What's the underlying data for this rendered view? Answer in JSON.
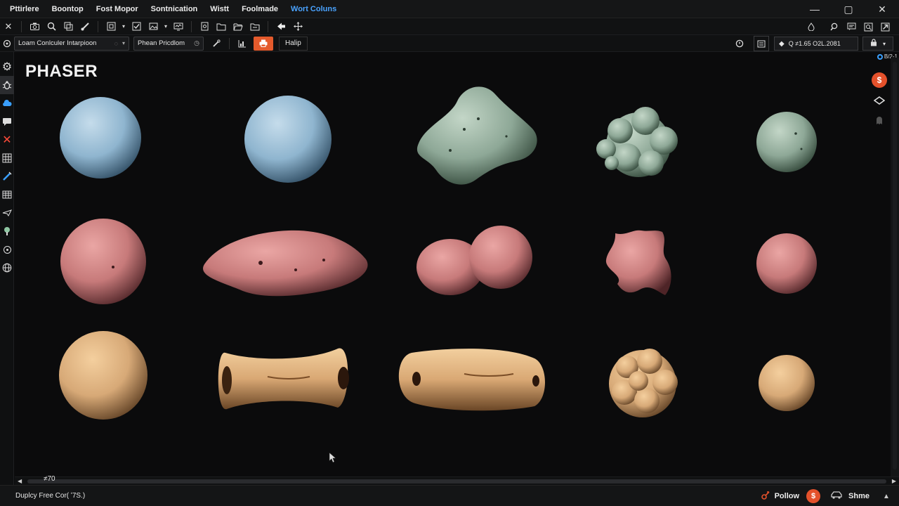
{
  "menubar": {
    "items": [
      "Pttirlere",
      "Boontop",
      "Fost Mopor",
      "Sontnication",
      "Wistt",
      "Foolmade",
      "Wort Coluns"
    ],
    "active_index": 6
  },
  "window_controls": {
    "minimize": "—",
    "maximize": "▢",
    "close": "✕"
  },
  "toolbar2": {
    "field1": "Loam Conlculer Intarpioon",
    "field2": "Phean Pricdlom",
    "help": "Halip",
    "coord_readout": "Q ≠1.65 O2L.2081"
  },
  "viewport": {
    "title": "PHASER"
  },
  "rightbar": {
    "label": "B/2-1",
    "coin": "$"
  },
  "hscroll": {
    "zoom": "≠70"
  },
  "statusbar": {
    "text": "Duplcy Free Cor( ʹ7S.)",
    "follow": "Pollow",
    "coin": "$",
    "share": "Shme"
  },
  "colors": {
    "blue_blob": "#8fb5cf",
    "green_blob": "#8ea897",
    "pink_blob": "#c77a7a",
    "tan_blob": "#d7a977",
    "accent_orange": "#e45a2c",
    "accent_blue": "#4aa3ff"
  }
}
